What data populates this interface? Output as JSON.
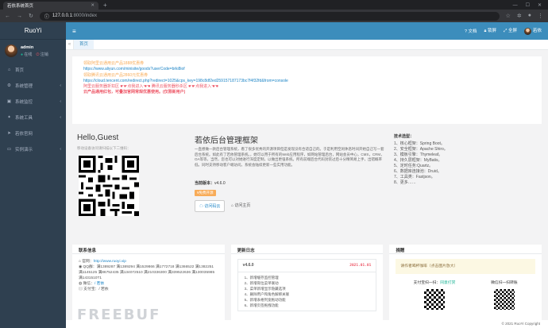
{
  "browser": {
    "tab_title": "若依系统首页",
    "url_host": "127.0.0.1",
    "url_path": ":8000/index"
  },
  "sidebar": {
    "logo": "RuoYi",
    "user": {
      "name": "admin",
      "online": "在线",
      "logout": "注销"
    },
    "items": [
      {
        "label": "首页",
        "icon": "home-icon"
      },
      {
        "label": "系统管理",
        "icon": "gear-icon"
      },
      {
        "label": "系统监控",
        "icon": "video-icon"
      },
      {
        "label": "系统工具",
        "icon": "tool-icon"
      },
      {
        "label": "若依官网",
        "icon": "send-icon"
      },
      {
        "label": "实例演示",
        "icon": "desktop-icon"
      }
    ]
  },
  "topbar": {
    "doc": "文档",
    "lock": "锁屏",
    "fullscreen": "全屏",
    "user": "若依"
  },
  "tabs": {
    "home": "首页"
  },
  "notice": {
    "l1": "领取阿里云通用云产品1888优惠券",
    "l2": "https://www.aliyun.com/minisite/goods?userCode=brki8iof",
    "l3": "领取腾讯云通用云产品2860元优惠券",
    "l4": "https://cloud.tencent.com/redirect.php?redirect=1025&cps_key=198c8df2ed259157187173bc7f4f32fd&from=console",
    "l5": "阿里云服务器折扣区 ☛☛点我进入☚☚   腾讯云服务器秒杀区 ☛☛点我进入☚☚",
    "l6": "云产品通用红包，可叠加官网常规优惠使用。(仅限新用户)"
  },
  "intro": {
    "hello": "Hello,Guest",
    "hello_sub": "移动设备访问请扫描以下二维码：",
    "title": "若依后台管理框架",
    "desc": "一直想做一款后台管理系统，看了很多优秀的开源项目但是发现没有合适自己的。于是利用空闲休息时间开始自己写一套后台系统。如此有了若依管理系统。，她可以用于所有的Web应用程序，如网站管理后台，网站会员中心，CMS，CRM，OA等等，当然，您也可以对她进行深度定制，以做出更强系统。所有前端后台代码封装过后十分精简易上手，出错概率低。同时支持移动客户端访问。系统会陆续更新一些实用功能。",
    "ver_label": "当前版本：",
    "ver_value": "v4.6.0",
    "free": "¥免费开源",
    "visit_btn": "访问码云",
    "home_btn": "访问主页",
    "tech_title": "技术选型：",
    "tech": [
      "1、核心框架：Spring Boot。",
      "2、安全框架：Apache Shiro。",
      "3、模板引擎：Thymeleaf。",
      "4、持久层框架：MyBatis。",
      "5、定时任务:Quartz。",
      "6、数据库连接池：Druid。",
      "7、工具类：Fastjson。",
      "8、更多……"
    ]
  },
  "contact": {
    "header": "联系信息",
    "site_label": "官网：",
    "site": "http://www.ruoyi.vip",
    "qq": "QQ群：满1389287 满1389294 满1529866 满1772718 满1366522 满1382251 满1145125 满86752435 满134072510 满210336300 满339522636 满130035985 满1431510T1",
    "wechat_label": "微信：",
    "wechat": "/ 若依",
    "alipay": "支付宝：/ 若依"
  },
  "changelog": {
    "header": "更新日志",
    "version": "v4.6.0",
    "date": "2021.01.01",
    "items": [
      "1、新增缓存监控管理",
      "2、新增岗位菜单联动",
      "3、菜单新增显示隐藏选项",
      "4、删除用户和角色解绑关联",
      "5、新增表格列宽拖动功能",
      "6、新增页签拖拽功能"
    ]
  },
  "donate": {
    "header": "捐赠",
    "alert": "请作者喝杯咖啡（点击图片放大）",
    "alipay_label": "支付宝扫一扫：",
    "alipay_link": "同意打赏",
    "wechat_label": "微信扫一扫转账"
  },
  "footer": "© 2021 RuoYi Copyright",
  "watermark": "FREEBUF"
}
